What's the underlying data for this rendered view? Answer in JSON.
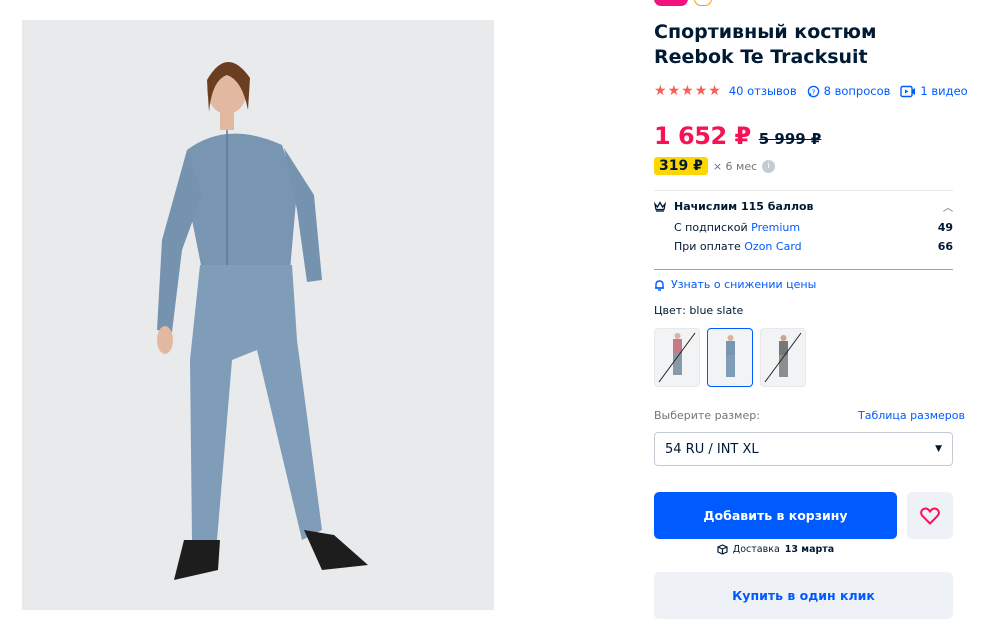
{
  "product": {
    "title": "Спортивный костюм Reebok Te Tracksuit",
    "rating_stars": 4.5,
    "reviews_link": "40 отзывов",
    "questions_link": "8 вопросов",
    "video_link": "1 видео"
  },
  "pricing": {
    "price": "1 652 ₽",
    "old_price": "5 999 ₽",
    "installment_amount": "319 ₽",
    "installment_term": "× 6 мес"
  },
  "points": {
    "header": "Начислим 115 баллов",
    "rows": [
      {
        "prefix": "С подпиской ",
        "link": "Premium",
        "value": "49"
      },
      {
        "prefix": "При оплате ",
        "link": "Ozon Card",
        "value": "66"
      }
    ]
  },
  "price_alert": "Узнать о снижении цены",
  "color": {
    "label": "Цвет:",
    "value": "blue slate",
    "options": [
      {
        "name": "pink",
        "selected": false,
        "available": false
      },
      {
        "name": "blue slate",
        "selected": true,
        "available": true
      },
      {
        "name": "grey",
        "selected": false,
        "available": false
      }
    ]
  },
  "size": {
    "label": "Выберите размер:",
    "table_link": "Таблица размеров",
    "selected": "54 RU / INT XL"
  },
  "actions": {
    "add_to_cart": "Добавить в корзину",
    "buy_one_click": "Купить в один клик"
  },
  "delivery": {
    "prefix": "Доставка",
    "date": "13 марта"
  },
  "colors": {
    "accent": "#005bff",
    "price": "#f91155",
    "installment": "#ffd600",
    "star": "#f96055"
  }
}
